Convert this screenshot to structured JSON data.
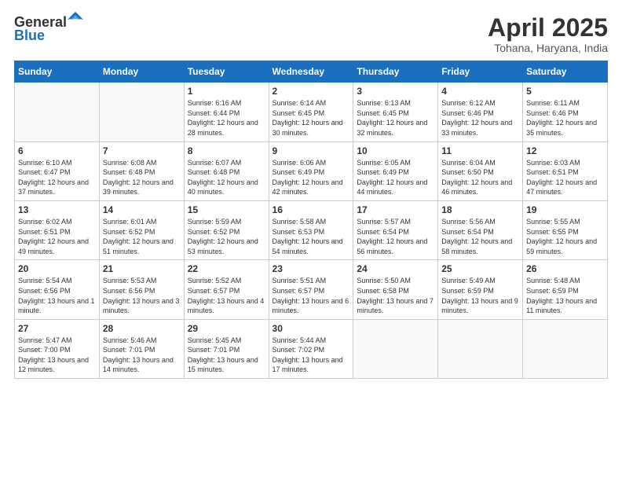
{
  "header": {
    "logo_general": "General",
    "logo_blue": "Blue",
    "month_title": "April 2025",
    "location": "Tohana, Haryana, India"
  },
  "weekdays": [
    "Sunday",
    "Monday",
    "Tuesday",
    "Wednesday",
    "Thursday",
    "Friday",
    "Saturday"
  ],
  "weeks": [
    [
      {
        "day": "",
        "info": ""
      },
      {
        "day": "",
        "info": ""
      },
      {
        "day": "1",
        "info": "Sunrise: 6:16 AM\nSunset: 6:44 PM\nDaylight: 12 hours and 28 minutes."
      },
      {
        "day": "2",
        "info": "Sunrise: 6:14 AM\nSunset: 6:45 PM\nDaylight: 12 hours and 30 minutes."
      },
      {
        "day": "3",
        "info": "Sunrise: 6:13 AM\nSunset: 6:45 PM\nDaylight: 12 hours and 32 minutes."
      },
      {
        "day": "4",
        "info": "Sunrise: 6:12 AM\nSunset: 6:46 PM\nDaylight: 12 hours and 33 minutes."
      },
      {
        "day": "5",
        "info": "Sunrise: 6:11 AM\nSunset: 6:46 PM\nDaylight: 12 hours and 35 minutes."
      }
    ],
    [
      {
        "day": "6",
        "info": "Sunrise: 6:10 AM\nSunset: 6:47 PM\nDaylight: 12 hours and 37 minutes."
      },
      {
        "day": "7",
        "info": "Sunrise: 6:08 AM\nSunset: 6:48 PM\nDaylight: 12 hours and 39 minutes."
      },
      {
        "day": "8",
        "info": "Sunrise: 6:07 AM\nSunset: 6:48 PM\nDaylight: 12 hours and 40 minutes."
      },
      {
        "day": "9",
        "info": "Sunrise: 6:06 AM\nSunset: 6:49 PM\nDaylight: 12 hours and 42 minutes."
      },
      {
        "day": "10",
        "info": "Sunrise: 6:05 AM\nSunset: 6:49 PM\nDaylight: 12 hours and 44 minutes."
      },
      {
        "day": "11",
        "info": "Sunrise: 6:04 AM\nSunset: 6:50 PM\nDaylight: 12 hours and 46 minutes."
      },
      {
        "day": "12",
        "info": "Sunrise: 6:03 AM\nSunset: 6:51 PM\nDaylight: 12 hours and 47 minutes."
      }
    ],
    [
      {
        "day": "13",
        "info": "Sunrise: 6:02 AM\nSunset: 6:51 PM\nDaylight: 12 hours and 49 minutes."
      },
      {
        "day": "14",
        "info": "Sunrise: 6:01 AM\nSunset: 6:52 PM\nDaylight: 12 hours and 51 minutes."
      },
      {
        "day": "15",
        "info": "Sunrise: 5:59 AM\nSunset: 6:52 PM\nDaylight: 12 hours and 53 minutes."
      },
      {
        "day": "16",
        "info": "Sunrise: 5:58 AM\nSunset: 6:53 PM\nDaylight: 12 hours and 54 minutes."
      },
      {
        "day": "17",
        "info": "Sunrise: 5:57 AM\nSunset: 6:54 PM\nDaylight: 12 hours and 56 minutes."
      },
      {
        "day": "18",
        "info": "Sunrise: 5:56 AM\nSunset: 6:54 PM\nDaylight: 12 hours and 58 minutes."
      },
      {
        "day": "19",
        "info": "Sunrise: 5:55 AM\nSunset: 6:55 PM\nDaylight: 12 hours and 59 minutes."
      }
    ],
    [
      {
        "day": "20",
        "info": "Sunrise: 5:54 AM\nSunset: 6:56 PM\nDaylight: 13 hours and 1 minute."
      },
      {
        "day": "21",
        "info": "Sunrise: 5:53 AM\nSunset: 6:56 PM\nDaylight: 13 hours and 3 minutes."
      },
      {
        "day": "22",
        "info": "Sunrise: 5:52 AM\nSunset: 6:57 PM\nDaylight: 13 hours and 4 minutes."
      },
      {
        "day": "23",
        "info": "Sunrise: 5:51 AM\nSunset: 6:57 PM\nDaylight: 13 hours and 6 minutes."
      },
      {
        "day": "24",
        "info": "Sunrise: 5:50 AM\nSunset: 6:58 PM\nDaylight: 13 hours and 7 minutes."
      },
      {
        "day": "25",
        "info": "Sunrise: 5:49 AM\nSunset: 6:59 PM\nDaylight: 13 hours and 9 minutes."
      },
      {
        "day": "26",
        "info": "Sunrise: 5:48 AM\nSunset: 6:59 PM\nDaylight: 13 hours and 11 minutes."
      }
    ],
    [
      {
        "day": "27",
        "info": "Sunrise: 5:47 AM\nSunset: 7:00 PM\nDaylight: 13 hours and 12 minutes."
      },
      {
        "day": "28",
        "info": "Sunrise: 5:46 AM\nSunset: 7:01 PM\nDaylight: 13 hours and 14 minutes."
      },
      {
        "day": "29",
        "info": "Sunrise: 5:45 AM\nSunset: 7:01 PM\nDaylight: 13 hours and 15 minutes."
      },
      {
        "day": "30",
        "info": "Sunrise: 5:44 AM\nSunset: 7:02 PM\nDaylight: 13 hours and 17 minutes."
      },
      {
        "day": "",
        "info": ""
      },
      {
        "day": "",
        "info": ""
      },
      {
        "day": "",
        "info": ""
      }
    ]
  ]
}
